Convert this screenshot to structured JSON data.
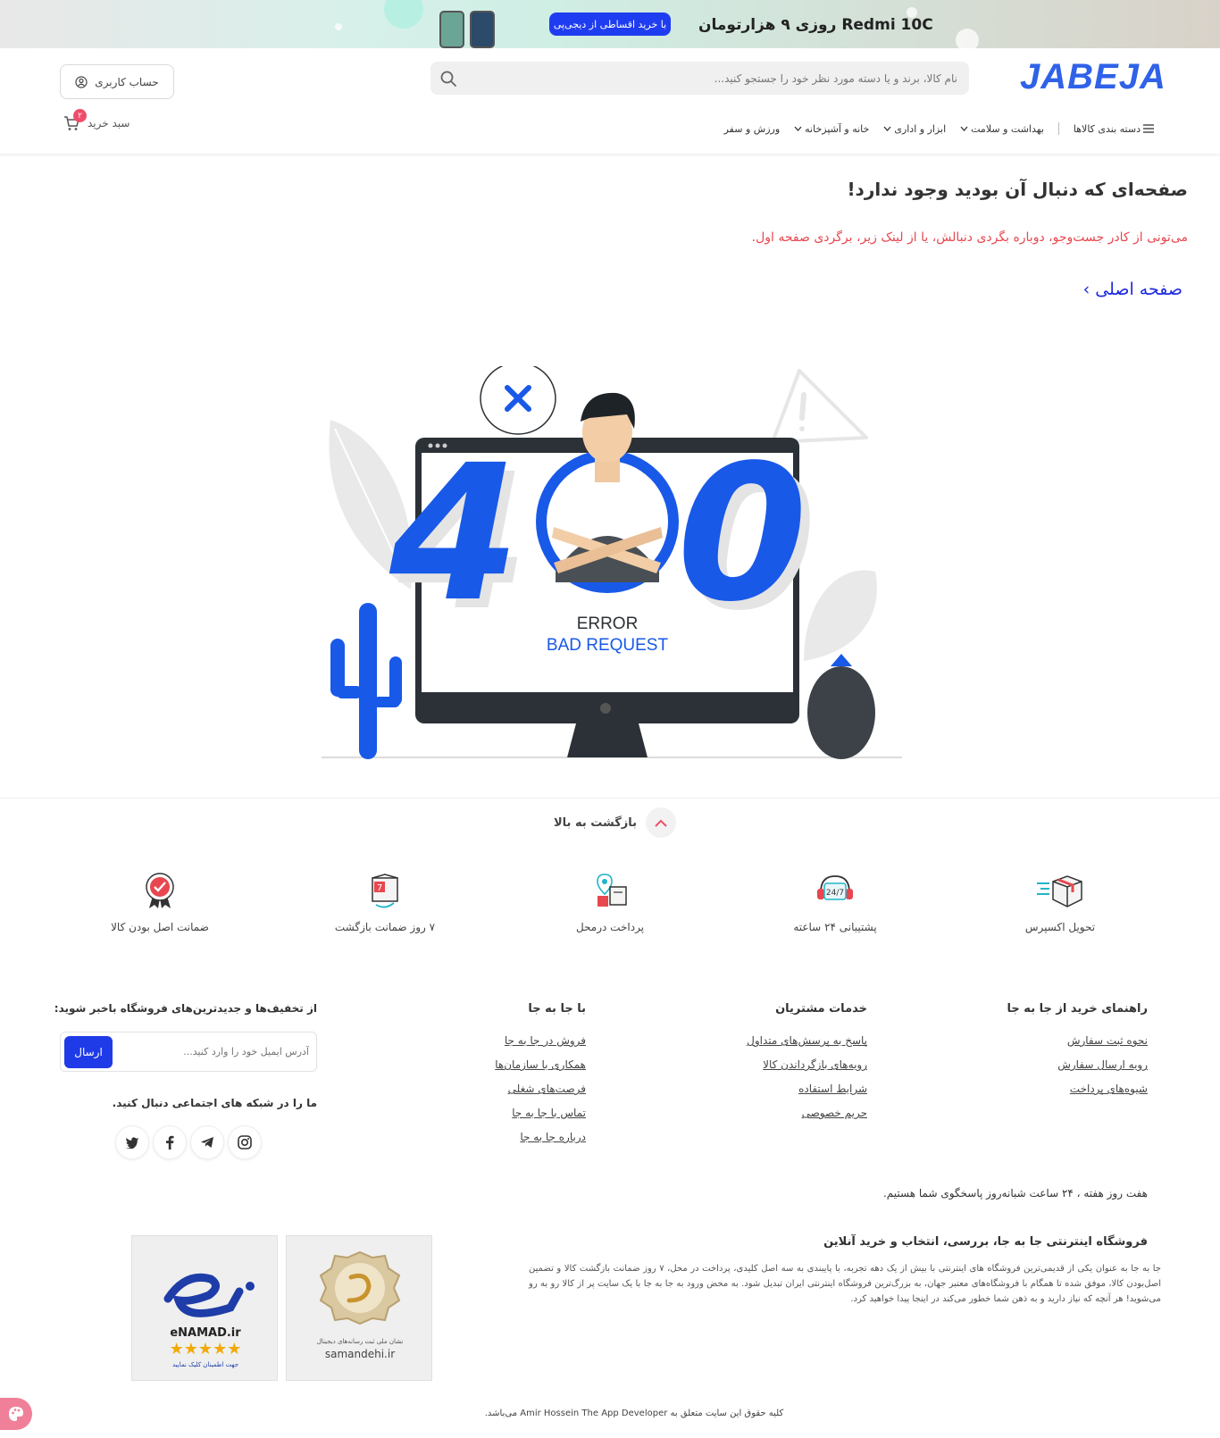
{
  "banner": {
    "promo_text": "Redmi 10C روزی ۹ هزارتومان",
    "cta_label": "با خرید اقساطی از دیجی‌پی"
  },
  "header": {
    "logo_text": "JABEJA",
    "search_placeholder": "نام کالا، برند و یا دسته مورد نظر خود را جستجو کنید...",
    "account_label": "حساب کاربری",
    "cart_label": "سبد خرید",
    "cart_count": "۲"
  },
  "nav": {
    "categories_label": "دسته بندی کالاها",
    "items": [
      {
        "label": "بهداشت و سلامت"
      },
      {
        "label": "ابزار و اداری"
      },
      {
        "label": "خانه و آشپزخانه"
      },
      {
        "label": "ورزش و سفر"
      }
    ]
  },
  "main": {
    "title": "صفحه‌ای که دنبال آن بودید وجود ندارد!",
    "subtitle": "می‌تونی از کادر جست‌وجو، دوباره بگردی دنبالش، یا از لینک زیر، برگردی صفحه اول.",
    "home_link": "صفحه اصلی",
    "illustration": {
      "code": "400",
      "error_text": "ERROR",
      "reason_text": "BAD REQUEST"
    }
  },
  "back_to_top": "بازگشت به بالا",
  "features": [
    {
      "label": "تحویل اکسپرس",
      "icon": "delivery-box-icon"
    },
    {
      "label": "پشتیبانی ۲۴ ساعته",
      "icon": "support-247-icon"
    },
    {
      "label": "پرداخت درمحل",
      "icon": "pay-on-delivery-icon"
    },
    {
      "label": "۷ روز ضمانت بازگشت",
      "icon": "return-7-days-icon"
    },
    {
      "label": "ضمانت اصل بودن کالا",
      "icon": "original-guarantee-icon"
    }
  ],
  "footer": {
    "guide": {
      "title": "راهنمای خرید از جا به جا",
      "links": [
        "نحوه ثبت سفارش",
        "رویه ارسال سفارش",
        "شیوه‌های پرداخت"
      ]
    },
    "services": {
      "title": "خدمات مشتریان",
      "links": [
        "پاسخ به پرسش‌های متداول",
        "رویه‌های بازگرداندن کالا",
        "شرایط استفاده",
        "حریم خصوصی"
      ]
    },
    "company": {
      "title": "با جا به جا",
      "links": [
        "فروش در جا به جا",
        "همکاری با سازمان‌ها",
        "فرصت‌های شغلی",
        "تماس با جا به جا",
        "درباره جا به جا"
      ]
    },
    "newsletter": {
      "title": "از تخفیف‌ها و جدیدترین‌های فروشگاه باخبر شوید:",
      "placeholder": "آدرس ایمیل خود را وارد کنید...",
      "button": "ارسال"
    },
    "social_title": "ما را در شبکه های اجتماعی دنبال کنید.",
    "availability": "هفت روز هفته ، ۲۴ ساعت شبانه‌روز پاسخگوی شما هستیم.",
    "about_title": "فروشگاه اینترنتی جا به جا، بررسی، انتخاب و خرید آنلاین",
    "about_text": "جا به جا به عنوان یکی از قدیمی‌ترین فروشگاه های اینترنتی با بیش از یک دهه تجربه، با پایبندی به سه اصل کلیدی، پرداخت در محل، ۷ روز ضمانت بازگشت کالا و تضمین اصل‌بودن کالا، موفق شده تا همگام با فروشگاه‌های معتبر جهان، به بزرگ‌ترین فروشگاه اینترنتی ایران تبدیل شود. به محض ورود به جا به جا با یک سایت پر از کالا رو به رو می‌شوید! هر آنچه که نیاز دارید و به ذهن شما خطور می‌کند در اینجا پیدا خواهید کرد.",
    "enamad_text": "eNAMAD.ir",
    "enamad_caption": "جهت اطمینان کلیک نمایید",
    "samandehi_text": "samandehi.ir",
    "samandehi_caption": "نشان ملی ثبت رسانه‌های دیجیتال",
    "copyright": "کلیه حقوق این سایت متعلق به Amir Hossein The App Developer می‌باشد."
  }
}
